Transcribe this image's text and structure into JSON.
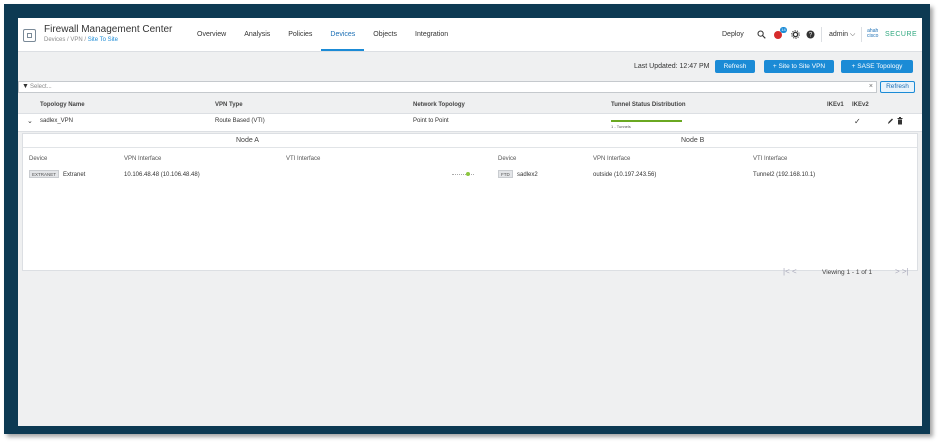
{
  "header": {
    "app_title": "Firewall Management Center",
    "breadcrumb_prefix": "Devices / VPN / ",
    "breadcrumb_current": "Site To Site",
    "nav": [
      "Overview",
      "Analysis",
      "Policies",
      "Devices",
      "Objects",
      "Integration"
    ],
    "active_nav": "Devices",
    "deploy_label": "Deploy",
    "notification_count": "14",
    "user_label": "admin ⌵",
    "brand_mark": "ahah\ncisco",
    "brand_label": "SECURE"
  },
  "toolbar": {
    "last_updated": "Last Updated: 12:47 PM",
    "refresh_label": "Refresh",
    "site_to_site_label": "+ Site to Site VPN",
    "sase_label": "+ SASE Topology"
  },
  "filter": {
    "placeholder": "Select...",
    "refresh_label": "Refresh"
  },
  "table": {
    "columns": [
      "Topology Name",
      "VPN Type",
      "Network Topology",
      "Tunnel Status Distribution",
      "IKEv1",
      "IKEv2"
    ],
    "row": {
      "name": "sadlex_VPN",
      "vpn_type": "Route Based (VTI)",
      "network_topology": "Point to Point",
      "tunnel_status": "1 - Tunnels",
      "ikev2_check": "✓"
    }
  },
  "detail": {
    "node_a_title": "Node A",
    "node_b_title": "Node B",
    "node_a_cols": [
      "Device",
      "VPN Interface",
      "VTI Interface"
    ],
    "node_b_cols": [
      "Device",
      "VPN Interface",
      "VTI Interface"
    ],
    "node_a": {
      "device_tag": "EXTRANET",
      "device_name": "Extranet",
      "vpn_interface": "10.106.48.48   (10.106.48.48)"
    },
    "node_b": {
      "device_tag": "FTD",
      "device_name": "sadlex2",
      "vpn_interface": "outside   (10.197.243.56)",
      "vti_interface": "Tunnel2   (192.168.10.1)"
    },
    "pager": {
      "first": "|< <",
      "text": "Viewing 1 - 1 of 1",
      "last": "> >|"
    }
  },
  "icons": [
    "search-icon",
    "notification-icon",
    "gear-icon",
    "help-icon",
    "funnel-icon",
    "clear-icon",
    "chevron-down-icon",
    "edit-icon",
    "delete-icon"
  ]
}
